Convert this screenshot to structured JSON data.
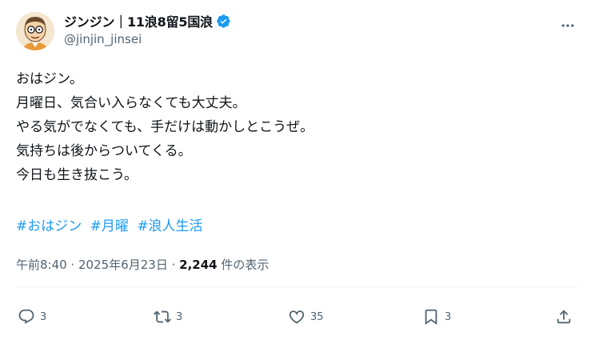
{
  "user": {
    "display_name": "ジンジン｜11浪8留5国浪",
    "handle": "@jinjin_jinsei",
    "avatar": "cartoon-man-with-glasses-avatar",
    "verified_icon": "verified-badge-icon",
    "verified_color": "#1d9bf0"
  },
  "menu": {
    "icon": "more-horizontal-icon"
  },
  "text": {
    "lines": [
      "おはジン。",
      "月曜日、気合い入らなくても大丈夫。",
      "やる気がでなくても、手だけは動かしとこうぜ。",
      "気持ちは後からついてくる。",
      "今日も生き抜こう。"
    ]
  },
  "hashtags": [
    "#おはジン",
    "#月曜",
    "#浪人生活"
  ],
  "meta": {
    "time": "午前8:40",
    "date": "2025年6月23日",
    "separator": "·",
    "views": "2,244",
    "views_label": "件の表示"
  },
  "actions": {
    "reply": {
      "icon": "reply-icon",
      "count": "3"
    },
    "repost": {
      "icon": "repost-icon",
      "count": "3"
    },
    "like": {
      "icon": "heart-icon",
      "count": "35"
    },
    "bookmark": {
      "icon": "bookmark-icon",
      "count": "3"
    },
    "share": {
      "icon": "share-icon"
    }
  },
  "colors": {
    "text": "#0f1419",
    "secondary": "#536471",
    "link": "#1d9bf0",
    "divider": "#eff3f4"
  }
}
